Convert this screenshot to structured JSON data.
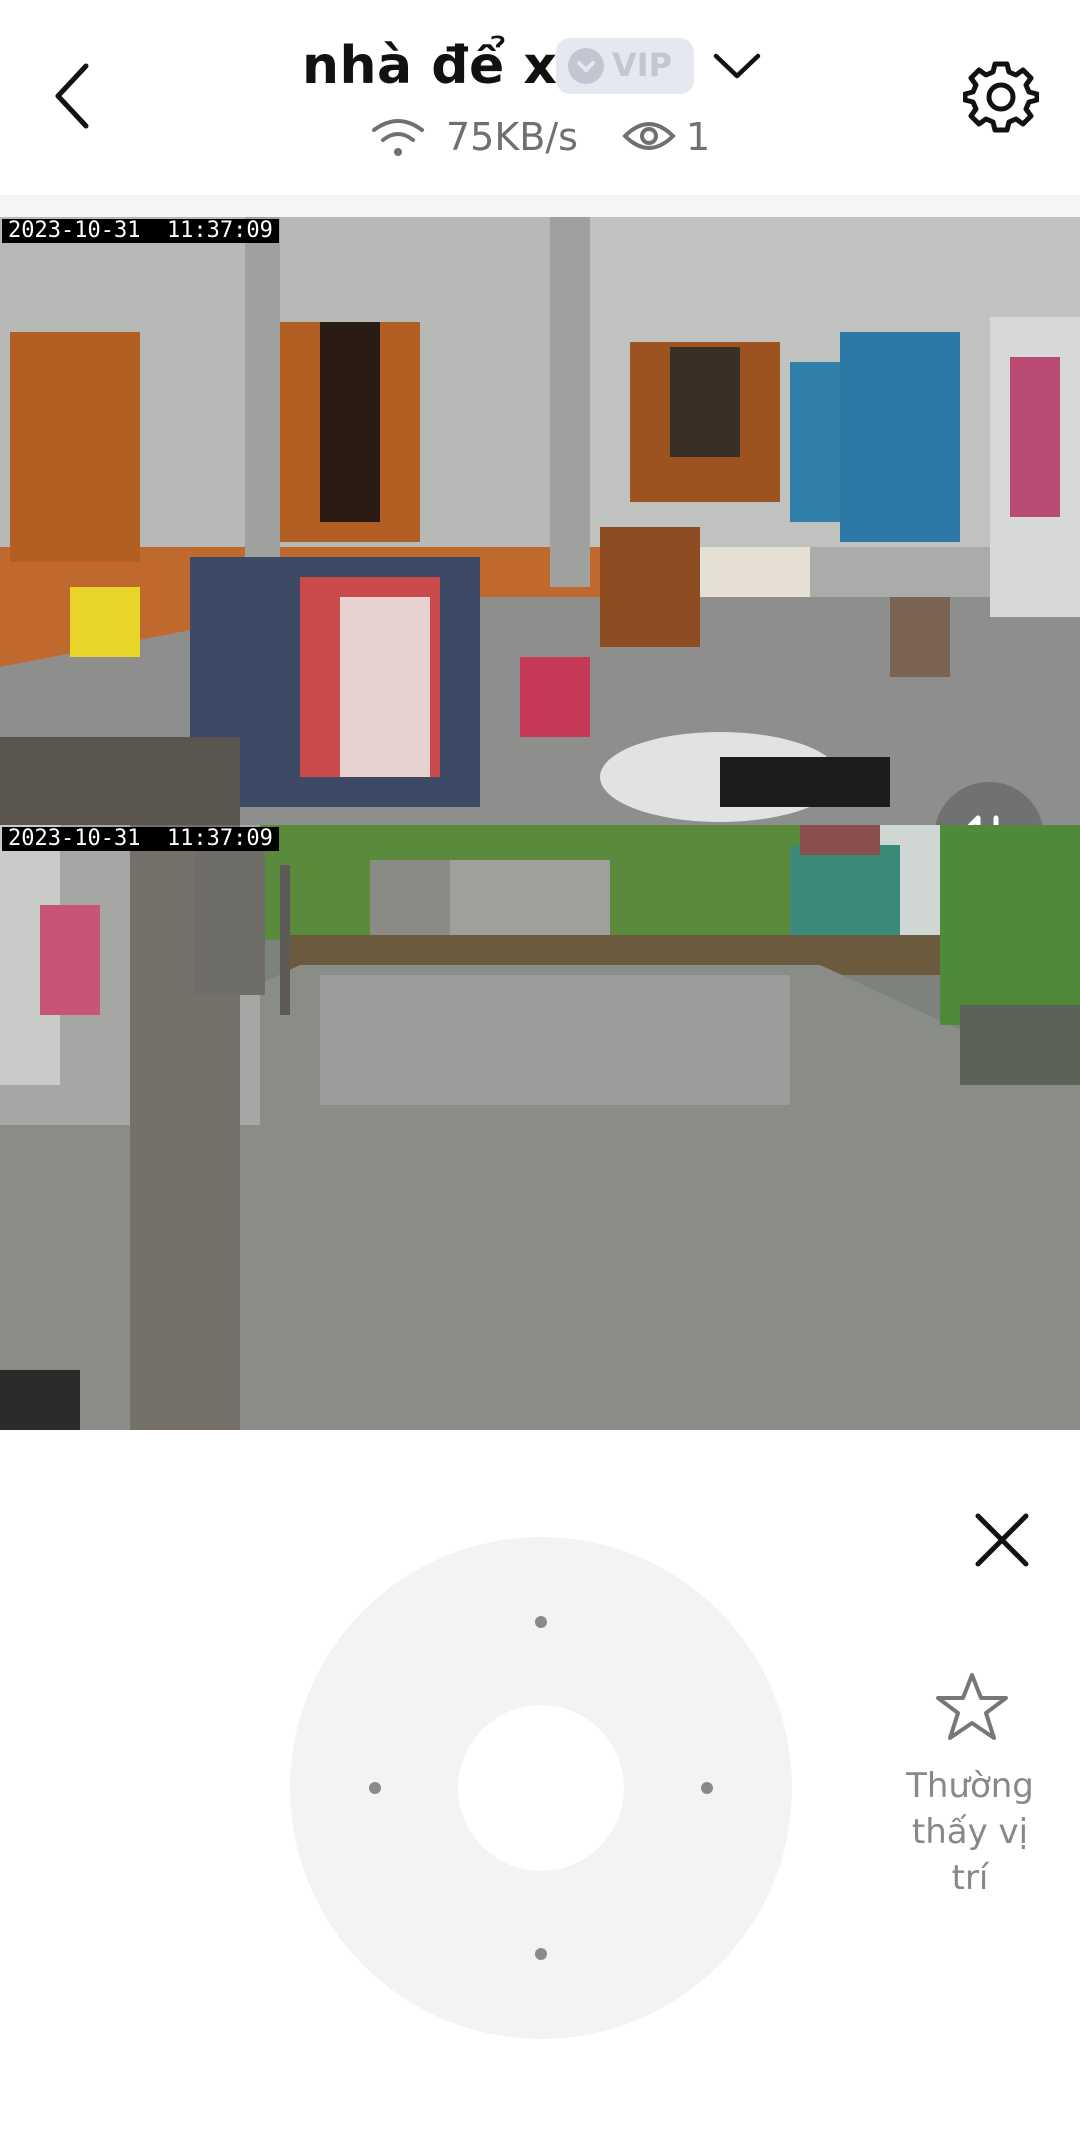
{
  "header": {
    "back_icon": "chevron-left-icon",
    "title": "nhà để xe",
    "vip_label": "VIP",
    "dropdown_icon": "chevron-down-icon",
    "settings_icon": "gear-icon",
    "speed": "75KB/s",
    "viewers": "1"
  },
  "feeds": [
    {
      "timestamp": "2023-10-31  11:37:09"
    },
    {
      "timestamp": "2023-10-31  11:37:09"
    }
  ],
  "controls": {
    "swap_icon": "swap-arrows-icon",
    "close_icon": "close-icon",
    "favorite_label_line1": "Thường",
    "favorite_label_line2": "thấy vị",
    "favorite_label_line3": "trí"
  },
  "colors": {
    "accent_text": "#707070",
    "vip_badge_bg": "#e6e8ef",
    "pad_bg": "#f3f3f3"
  }
}
